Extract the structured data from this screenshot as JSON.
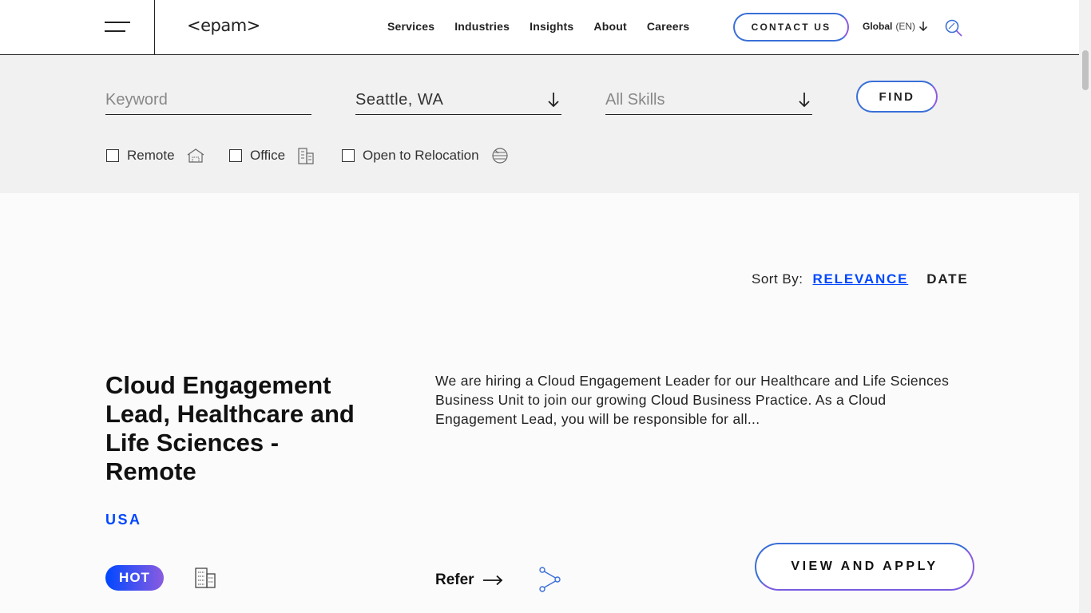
{
  "header": {
    "logo": "<epam>",
    "nav": [
      "Services",
      "Industries",
      "Insights",
      "About",
      "Careers"
    ],
    "contact_label": "CONTACT US",
    "global_label": "Global",
    "global_lang": "(EN)"
  },
  "filters": {
    "keyword_placeholder": "Keyword",
    "location_value": "Seattle, WA",
    "skills_placeholder": "All Skills",
    "find_label": "FIND",
    "checkboxes": [
      {
        "label": "Remote",
        "icon": "remote-house-icon"
      },
      {
        "label": "Office",
        "icon": "office-building-icon"
      },
      {
        "label": "Open to Relocation",
        "icon": "relocation-globe-icon"
      }
    ]
  },
  "sort": {
    "label": "Sort By:",
    "relevance": "RELEVANCE",
    "date": "DATE"
  },
  "job": {
    "title": "Cloud Engagement Lead, Healthcare and Life Sciences - Remote",
    "location": "USA",
    "badge": "HOT",
    "description": "We are hiring a Cloud Engagement Leader for our Healthcare and Life Sciences Business Unit to join our growing Cloud Business Practice. As a Cloud Engagement Lead, you will be responsible for all...",
    "refer_label": "Refer",
    "apply_label": "VIEW AND APPLY"
  },
  "colors": {
    "accent_blue": "#0047ff",
    "accent_purple": "#8a5ce0"
  }
}
